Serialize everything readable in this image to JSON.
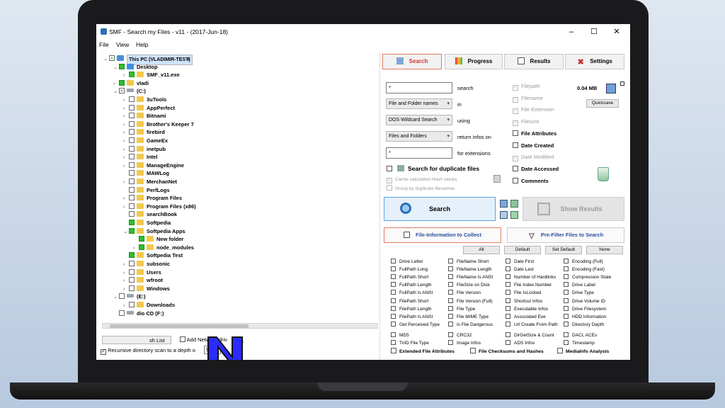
{
  "window": {
    "title": "SMF - Search my Files - v11 - (2017-Jun-18)",
    "min": "–",
    "max": "☐",
    "close": "✕"
  },
  "menu": [
    "File",
    "View",
    "Help"
  ],
  "tree": [
    {
      "label": "This PC (VLADIMIR-TEST)",
      "indent": 0,
      "exp": "⌄",
      "cb": "part",
      "icon": "pc",
      "sel": true
    },
    {
      "label": "Desktop",
      "indent": 1,
      "exp": "⌄",
      "cb": "on",
      "icon": "bl"
    },
    {
      "label": "SMF_v11.exe",
      "indent": 2,
      "exp": "›",
      "cb": "on",
      "icon": "fd"
    },
    {
      "label": "vladi",
      "indent": 1,
      "exp": "›",
      "cb": "on",
      "icon": "fd"
    },
    {
      "label": "(C:)",
      "indent": 1,
      "exp": "⌄",
      "cb": "part",
      "icon": "dr"
    },
    {
      "label": "3uTools",
      "indent": 2,
      "exp": "›",
      "cb": "off",
      "icon": "fd"
    },
    {
      "label": "AppPerfect",
      "indent": 2,
      "exp": "›",
      "cb": "off",
      "icon": "fd"
    },
    {
      "label": "Bitnami",
      "indent": 2,
      "exp": "›",
      "cb": "off",
      "icon": "fd"
    },
    {
      "label": "Brother's Keeper 7",
      "indent": 2,
      "exp": "›",
      "cb": "off",
      "icon": "fd"
    },
    {
      "label": "firebird",
      "indent": 2,
      "exp": "›",
      "cb": "off",
      "icon": "fd"
    },
    {
      "label": "GameEx",
      "indent": 2,
      "exp": "›",
      "cb": "off",
      "icon": "fd"
    },
    {
      "label": "inetpub",
      "indent": 2,
      "exp": "›",
      "cb": "off",
      "icon": "fd"
    },
    {
      "label": "Intel",
      "indent": 2,
      "exp": "›",
      "cb": "off",
      "icon": "fd"
    },
    {
      "label": "ManageEngine",
      "indent": 2,
      "exp": "›",
      "cb": "off",
      "icon": "fd"
    },
    {
      "label": "MAWLog",
      "indent": 2,
      "exp": "",
      "cb": "off",
      "icon": "fd"
    },
    {
      "label": "MerchanNet",
      "indent": 2,
      "exp": "›",
      "cb": "off",
      "icon": "fd"
    },
    {
      "label": "PerfLogs",
      "indent": 2,
      "exp": "",
      "cb": "off",
      "icon": "fd"
    },
    {
      "label": "Program Files",
      "indent": 2,
      "exp": "›",
      "cb": "off",
      "icon": "fd"
    },
    {
      "label": "Program Files (x86)",
      "indent": 2,
      "exp": "›",
      "cb": "off",
      "icon": "fd"
    },
    {
      "label": "searchBook",
      "indent": 2,
      "exp": "",
      "cb": "off",
      "icon": "fd"
    },
    {
      "label": "Softpedia",
      "indent": 2,
      "exp": "",
      "cb": "on",
      "icon": "fd"
    },
    {
      "label": "Softpedia Apps",
      "indent": 2,
      "exp": "⌄",
      "cb": "on",
      "icon": "fd"
    },
    {
      "label": "New folder",
      "indent": 3,
      "exp": "",
      "cb": "on",
      "icon": "fd"
    },
    {
      "label": "node_modules",
      "indent": 3,
      "exp": "›",
      "cb": "on",
      "icon": "fd"
    },
    {
      "label": "Softpedia Test",
      "indent": 2,
      "exp": "",
      "cb": "on",
      "icon": "fd"
    },
    {
      "label": "subsonic",
      "indent": 2,
      "exp": "›",
      "cb": "off",
      "icon": "fd"
    },
    {
      "label": "Users",
      "indent": 2,
      "exp": "›",
      "cb": "off",
      "icon": "fd"
    },
    {
      "label": "wfroot",
      "indent": 2,
      "exp": "›",
      "cb": "off",
      "icon": "fd"
    },
    {
      "label": "Windows",
      "indent": 2,
      "exp": "›",
      "cb": "off",
      "icon": "fd"
    },
    {
      "label": "(E:)",
      "indent": 1,
      "exp": "⌄",
      "cb": "off",
      "icon": "dr"
    },
    {
      "label": "Downloads",
      "indent": 2,
      "exp": "›",
      "cb": "off",
      "icon": "fd"
    },
    {
      "label": "dio CD (F:)",
      "indent": 1,
      "exp": "",
      "cb": "off",
      "icon": "dr"
    }
  ],
  "left_bottom": {
    "hash_list": "sh List",
    "add_network": "Add Network driv",
    "recursive": "Recursive directory scan to a depth o",
    "depth": "999"
  },
  "tabs": {
    "search": "Search",
    "progress": "Progress",
    "results": "Results",
    "settings": "Settings"
  },
  "form": {
    "search_value": "*",
    "search_lbl": "search",
    "in_value": "File and Folder names",
    "in_lbl": "in",
    "using_value": "DOS Wildcard Search",
    "using_lbl": "using",
    "return_value": "Files and Folders",
    "return_lbl": "return infos on",
    "ext_value": "*",
    "ext_lbl": "for extensions",
    "dup": "Search for duplicate files",
    "cache": "Cache calculated Hash values",
    "group": "Group by duplicate filenames"
  },
  "infos": [
    {
      "label": "Filepath",
      "state": "dis"
    },
    {
      "label": "Filename",
      "state": "dis"
    },
    {
      "label": "File Extension",
      "state": "dis"
    },
    {
      "label": "Filesize",
      "state": "dis"
    },
    {
      "label": "File Attributes",
      "state": "b"
    },
    {
      "label": "Date Created",
      "state": "b"
    },
    {
      "label": "Date Modified",
      "state": "dis"
    },
    {
      "label": "Date Accessed",
      "state": "b"
    },
    {
      "label": "Comments",
      "state": "b"
    }
  ],
  "size": "0.04 MB",
  "quicksave": "Quicksave",
  "search_btn": "Search",
  "show_results": "Show Results",
  "fileinfo_btn": "File-Information to Collect",
  "prefilter_btn": "Pre-Filter Files to Search",
  "presets": [
    "All",
    "Default",
    "Set Default",
    "None"
  ],
  "grid": [
    [
      "Drive Letter",
      "FullPath Long",
      "FullPath Short",
      "FullPath Length",
      "FullPath Is ANSI",
      "FilePath Short",
      "FilePath Length",
      "FilePath Is ANSI",
      "Get Perceived Type"
    ],
    [
      "FileName Short",
      "FileName Length",
      "FileName Is ANSI",
      "FileSize on Disk",
      "File Version",
      "File Version (Full)",
      "File Type",
      "File MIME Type",
      "Is File Dangerous"
    ],
    [
      "Date First",
      "Date Last",
      "Number of Hardlinks",
      "File Index Number",
      "File IsLocked",
      "Shortcut Infos",
      "Executable Infos",
      "Associated Exe",
      "Url Create From Path"
    ],
    [
      "Encoding (Full)",
      "Encoding (Fast)",
      "Compression State",
      "Drive Label",
      "Drive Type",
      "Drive Volume ID",
      "Drive Filesystem",
      "HDD Information",
      "Directory Depth"
    ]
  ],
  "grid2": [
    [
      "MD5",
      "TriID File Type"
    ],
    [
      "CRC32",
      "Image Infos"
    ],
    [
      "DirGetSize & Count",
      "ADS Infos"
    ],
    [
      "DACL ACEs",
      "Timestamp"
    ]
  ],
  "bottom": {
    "ext": "Extended File Attributes",
    "chk": "File Checksums and Hashes",
    "media": "MediaInfo Analysis"
  }
}
